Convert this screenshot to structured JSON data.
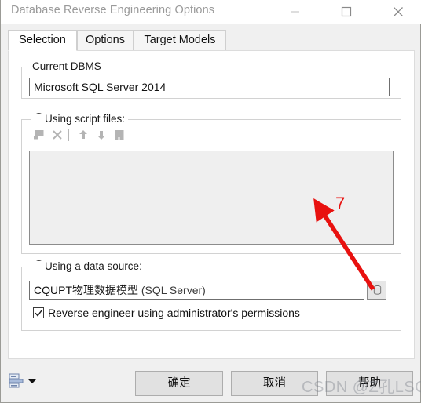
{
  "window": {
    "title": "Database Reverse Engineering Options",
    "controls": {
      "minimize": "minimize-button",
      "maximize": "maximize-button",
      "close": "close-button"
    }
  },
  "tabs": [
    {
      "label": "Selection",
      "active": true
    },
    {
      "label": "Options",
      "active": false
    },
    {
      "label": "Target Models",
      "active": false
    }
  ],
  "groups": {
    "dbms": {
      "label": "Current DBMS",
      "value": "Microsoft SQL Server 2014"
    },
    "script": {
      "label": "Using script files:",
      "selected": false,
      "toolbar": [
        {
          "name": "add-script-file-icon",
          "title": "Add"
        },
        {
          "name": "delete-script-file-icon",
          "title": "Delete"
        },
        {
          "name": "move-up-icon",
          "title": "Move Up"
        },
        {
          "name": "move-down-icon",
          "title": "Move Down"
        },
        {
          "name": "edit-script-file-icon",
          "title": "Edit"
        }
      ],
      "list_items": []
    },
    "source": {
      "label": "Using a data source:",
      "selected": true,
      "value_cjk": "CQUPT物理数据模型",
      "value_latin": " (SQL Server)",
      "browse_icon": "database-icon",
      "checkbox": {
        "label": "Reverse engineer using administrator's permissions",
        "checked": true
      }
    }
  },
  "footer": {
    "menu_icon": "report-list-icon",
    "dropdown_icon": "chevron-down-icon",
    "buttons": [
      {
        "label": "确定",
        "name": "ok-button"
      },
      {
        "label": "取消",
        "name": "cancel-button"
      },
      {
        "label": "帮助",
        "name": "help-button"
      }
    ]
  },
  "annotation": {
    "number": "7",
    "color": "#e8110f"
  },
  "watermark": {
    "text": "CSDN @Z孔LSQ_"
  },
  "colors": {
    "dialog_bg": "#f0f0f0",
    "tab_page_bg": "#ffffff",
    "field_border": "#6f6f6f",
    "disabled_list_bg": "#efefef",
    "annotation_red": "#e8110f"
  }
}
